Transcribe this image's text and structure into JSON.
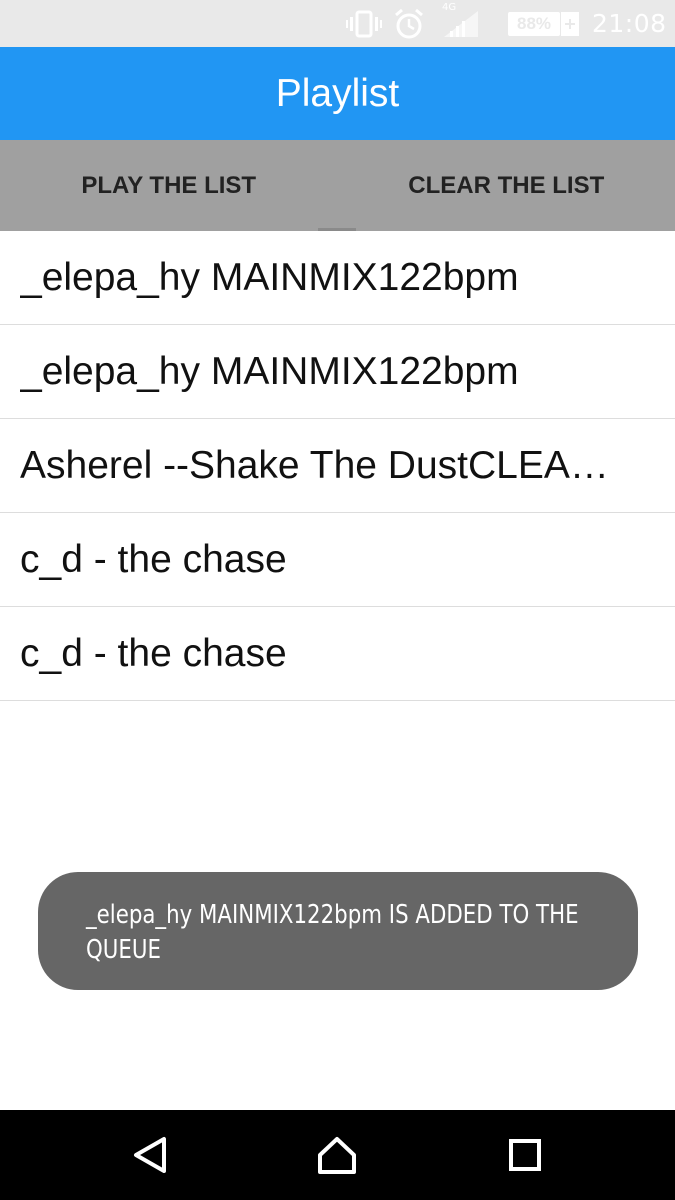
{
  "status_bar": {
    "network_type": "4G",
    "battery_percent": "88%",
    "time": "21:08",
    "icons": [
      "vibrate-icon",
      "alarm-icon",
      "signal-icon",
      "battery-icon"
    ]
  },
  "app_bar": {
    "title": "Playlist",
    "color": "#2196f3"
  },
  "actions": {
    "play_label": "PLAY THE LIST",
    "clear_label": "CLEAR THE LIST"
  },
  "playlist": {
    "items": [
      {
        "title": "_elepa_hy MAINMIX122bpm"
      },
      {
        "title": "_elepa_hy MAINMIX122bpm"
      },
      {
        "title": "Asherel --Shake The DustCLEAN…"
      },
      {
        "title": "c_d - the chase"
      },
      {
        "title": "c_d - the chase"
      }
    ]
  },
  "toast": {
    "message": "_elepa_hy MAINMIX122bpm IS ADDED TO THE QUEUE"
  },
  "nav_bar": {
    "icons": [
      "back-icon",
      "home-icon",
      "recents-icon"
    ]
  }
}
